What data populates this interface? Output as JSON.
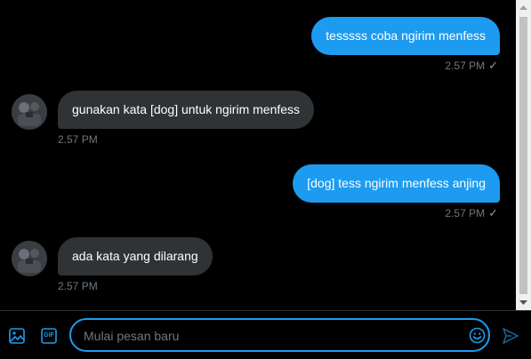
{
  "messages": [
    {
      "direction": "sent",
      "text": "tesssss coba ngirim menfess",
      "time": "2.57 PM"
    },
    {
      "direction": "received",
      "text": "gunakan kata [dog] untuk ngirim menfess",
      "time": "2.57 PM"
    },
    {
      "direction": "sent",
      "text": "[dog] tess ngirim menfess anjing",
      "time": "2.57 PM"
    },
    {
      "direction": "received",
      "text": "ada kata yang dilarang",
      "time": "2.57 PM"
    }
  ],
  "composer": {
    "placeholder": "Mulai pesan baru",
    "gif_label": "GIF",
    "icons": [
      "image-icon",
      "gif-icon",
      "emoji-icon",
      "send-icon"
    ]
  },
  "colors": {
    "accent": "#1d9bf0",
    "received_bubble": "#2f3336",
    "background": "#000000",
    "timestamp": "#71767b"
  }
}
